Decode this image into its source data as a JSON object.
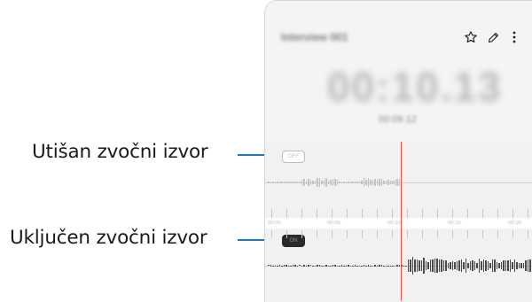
{
  "callouts": {
    "muted_source": "Utišan zvočni izvor",
    "active_source": "Uključen zvočni izvor"
  },
  "recording": {
    "title": "Interview 001",
    "timer": "00:10.13",
    "subtime": "00:09.12"
  },
  "tracks": {
    "muted_chip_label": "OFF",
    "active_chip_label": "ON"
  },
  "timeline": {
    "labels": [
      "00:00",
      "00:05",
      "00:10",
      "00:15",
      "00:20"
    ]
  },
  "colors": {
    "leader": "#1f77b4",
    "playhead": "#ef5350",
    "active_wave": "#4a4a4a",
    "muted_wave": "#c2c2c2"
  }
}
